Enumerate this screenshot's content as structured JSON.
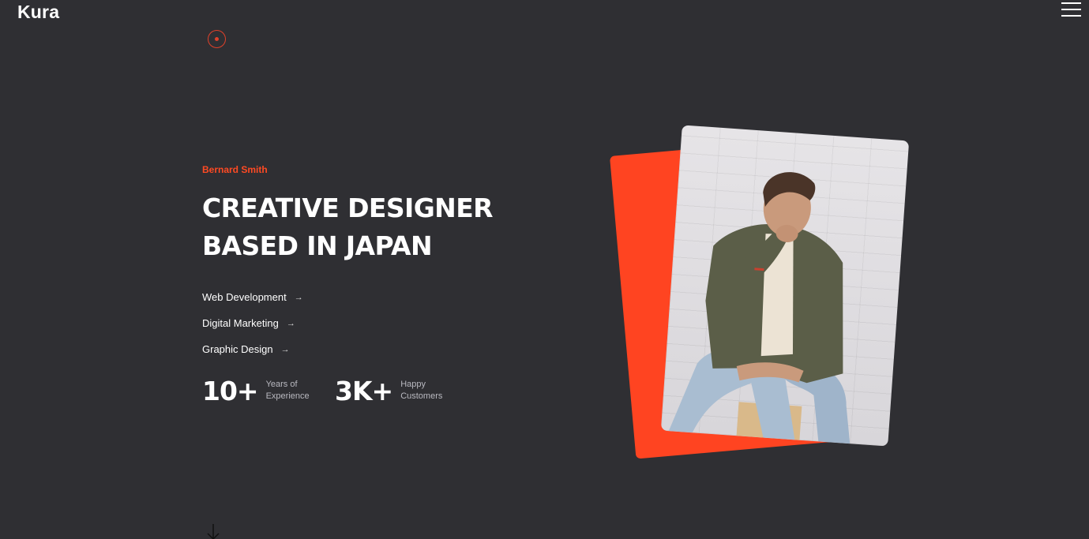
{
  "brand": {
    "logo": "Kura"
  },
  "nav": {
    "menu_icon": "hamburger-menu-icon"
  },
  "hero": {
    "name": "Bernard Smith",
    "headline_line1": "CREATIVE DESIGNER",
    "headline_line2": "BASED IN JAPAN",
    "services": [
      {
        "label": "Web Development",
        "icon": "arrow-right-icon"
      },
      {
        "label": "Digital Marketing",
        "icon": "arrow-right-icon"
      },
      {
        "label": "Graphic Design",
        "icon": "arrow-right-icon"
      }
    ],
    "stats": [
      {
        "value": "10+",
        "label_line1": "Years of",
        "label_line2": "Experience"
      },
      {
        "value": "3K+",
        "label_line1": "Happy",
        "label_line2": "Customers"
      }
    ]
  },
  "colors": {
    "background": "#2f2f33",
    "accent": "#ff4421",
    "text": "#ffffff",
    "muted": "#b9b9c0"
  },
  "icons": {
    "scroll": "arrow-down-icon",
    "cursor": "cursor-ring-icon"
  }
}
